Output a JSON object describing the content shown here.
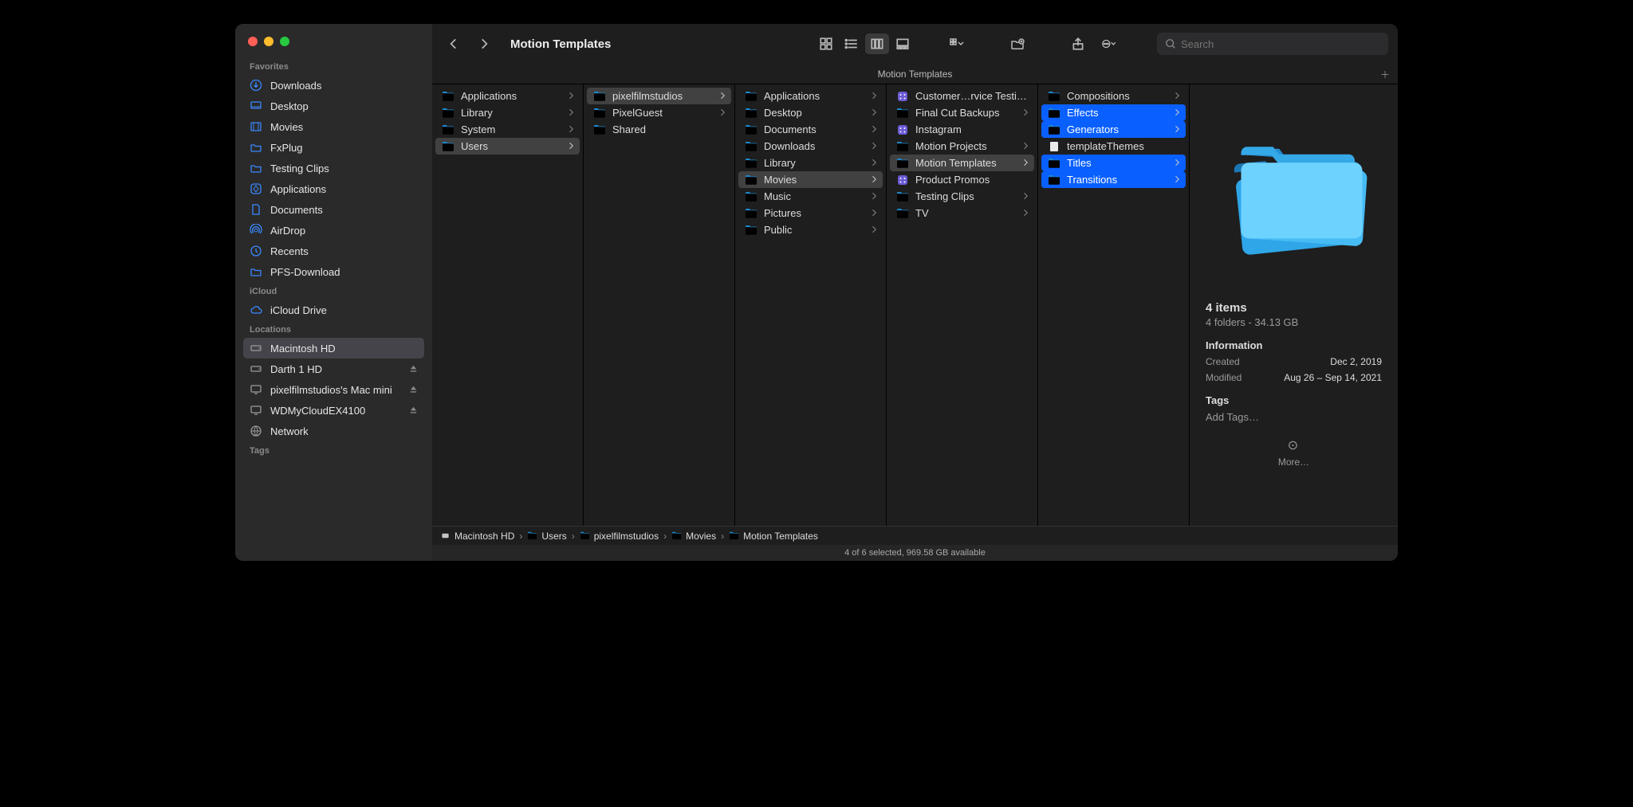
{
  "window": {
    "title": "Motion Templates",
    "tab_title": "Motion Templates"
  },
  "search": {
    "placeholder": "Search"
  },
  "sidebar": {
    "sections": [
      {
        "label": "Favorites",
        "items": [
          {
            "label": "Downloads",
            "icon": "download-circle"
          },
          {
            "label": "Desktop",
            "icon": "desktop"
          },
          {
            "label": "Movies",
            "icon": "film"
          },
          {
            "label": "FxPlug",
            "icon": "folder"
          },
          {
            "label": "Testing Clips",
            "icon": "folder"
          },
          {
            "label": "Applications",
            "icon": "app-grid"
          },
          {
            "label": "Documents",
            "icon": "doc"
          },
          {
            "label": "AirDrop",
            "icon": "airdrop"
          },
          {
            "label": "Recents",
            "icon": "clock"
          },
          {
            "label": "PFS-Download",
            "icon": "folder"
          }
        ]
      },
      {
        "label": "iCloud",
        "items": [
          {
            "label": "iCloud Drive",
            "icon": "cloud"
          }
        ]
      },
      {
        "label": "Locations",
        "items": [
          {
            "label": "Macintosh HD",
            "icon": "hdd",
            "active": true
          },
          {
            "label": "Darth 1 HD",
            "icon": "hdd",
            "eject": true
          },
          {
            "label": "pixelfilmstudios's Mac mini",
            "icon": "display",
            "eject": true
          },
          {
            "label": "WDMyCloudEX4100",
            "icon": "display",
            "eject": true
          },
          {
            "label": "Network",
            "icon": "globe"
          }
        ]
      },
      {
        "label": "Tags",
        "items": []
      }
    ]
  },
  "columns": [
    {
      "items": [
        {
          "label": "Applications",
          "type": "folder",
          "state": "",
          "children": true
        },
        {
          "label": "Library",
          "type": "folder",
          "state": "",
          "children": true
        },
        {
          "label": "System",
          "type": "folder",
          "state": "",
          "children": true
        },
        {
          "label": "Users",
          "type": "folder",
          "state": "in-path",
          "children": true
        }
      ]
    },
    {
      "items": [
        {
          "label": "pixelfilmstudios",
          "type": "folder",
          "state": "in-path",
          "children": true
        },
        {
          "label": "PixelGuest",
          "type": "folder",
          "state": "",
          "children": true
        },
        {
          "label": "Shared",
          "type": "folder",
          "state": "",
          "children": false
        }
      ]
    },
    {
      "items": [
        {
          "label": "Applications",
          "type": "folder",
          "state": "",
          "children": true
        },
        {
          "label": "Desktop",
          "type": "folder",
          "state": "",
          "children": true
        },
        {
          "label": "Documents",
          "type": "folder",
          "state": "",
          "children": true
        },
        {
          "label": "Downloads",
          "type": "folder",
          "state": "",
          "children": true
        },
        {
          "label": "Library",
          "type": "folder",
          "state": "",
          "children": true
        },
        {
          "label": "Movies",
          "type": "folder",
          "state": "in-path",
          "children": true
        },
        {
          "label": "Music",
          "type": "folder",
          "state": "",
          "children": true
        },
        {
          "label": "Pictures",
          "type": "folder",
          "state": "",
          "children": true
        },
        {
          "label": "Public",
          "type": "folder",
          "state": "",
          "children": true
        }
      ]
    },
    {
      "items": [
        {
          "label": "Customer…rvice Testing",
          "type": "app",
          "state": "",
          "children": false
        },
        {
          "label": "Final Cut Backups",
          "type": "folder",
          "state": "",
          "children": true
        },
        {
          "label": "Instagram",
          "type": "app",
          "state": "",
          "children": false
        },
        {
          "label": "Motion Projects",
          "type": "folder",
          "state": "",
          "children": true
        },
        {
          "label": "Motion Templates",
          "type": "folder",
          "state": "in-path",
          "children": true
        },
        {
          "label": "Product Promos",
          "type": "app",
          "state": "",
          "children": false
        },
        {
          "label": "Testing Clips",
          "type": "folder",
          "state": "",
          "children": true
        },
        {
          "label": "TV",
          "type": "folder",
          "state": "",
          "children": true
        }
      ]
    },
    {
      "items": [
        {
          "label": "Compositions",
          "type": "folder",
          "state": "",
          "children": true
        },
        {
          "label": "Effects",
          "type": "folder",
          "state": "selected",
          "children": true
        },
        {
          "label": "Generators",
          "type": "folder",
          "state": "selected",
          "children": true
        },
        {
          "label": "templateThemes",
          "type": "file",
          "state": "",
          "children": false
        },
        {
          "label": "Titles",
          "type": "folder",
          "state": "selected",
          "children": true
        },
        {
          "label": "Transitions",
          "type": "folder",
          "state": "selected",
          "children": true
        }
      ]
    }
  ],
  "preview": {
    "title": "4 items",
    "subtitle": "4 folders - 34.13 GB",
    "info_label": "Information",
    "created_label": "Created",
    "created_value": "Dec 2, 2019",
    "modified_label": "Modified",
    "modified_value": "Aug 26 – Sep 14, 2021",
    "tags_label": "Tags",
    "add_tags": "Add Tags…",
    "more_label": "More…"
  },
  "path": [
    {
      "label": "Macintosh HD",
      "icon": "hdd"
    },
    {
      "label": "Users",
      "icon": "folder"
    },
    {
      "label": "pixelfilmstudios",
      "icon": "folder"
    },
    {
      "label": "Movies",
      "icon": "folder"
    },
    {
      "label": "Motion Templates",
      "icon": "folder"
    }
  ],
  "status": "4 of 6 selected, 969.58 GB available"
}
